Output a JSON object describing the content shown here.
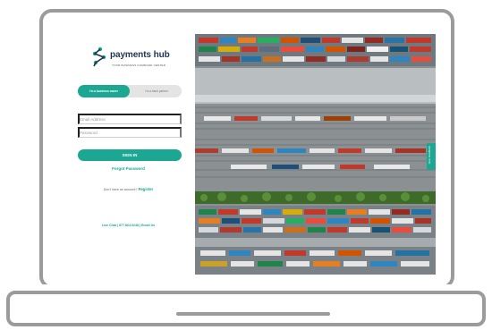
{
  "brand": {
    "name": "payments hub",
    "tagline": "YOUR BUSINESS COMMAND CENTER",
    "primary_color": "#1ba792",
    "logo_icon": "payments-hub-logo-icon"
  },
  "login": {
    "toggle": {
      "active": "I'm a business owner",
      "inactive": "I'm a bank partner"
    },
    "email_placeholder": "Email Address",
    "password_placeholder": "Password",
    "sign_in_label": "SIGN IN",
    "forgot_password": "Forgot Password",
    "no_account_text": "Don't have an account?",
    "register_link": "Register",
    "footer_links": "Live Chat | 877.864.0248 | Email Us"
  },
  "feedback_tab": "Give Feedback"
}
